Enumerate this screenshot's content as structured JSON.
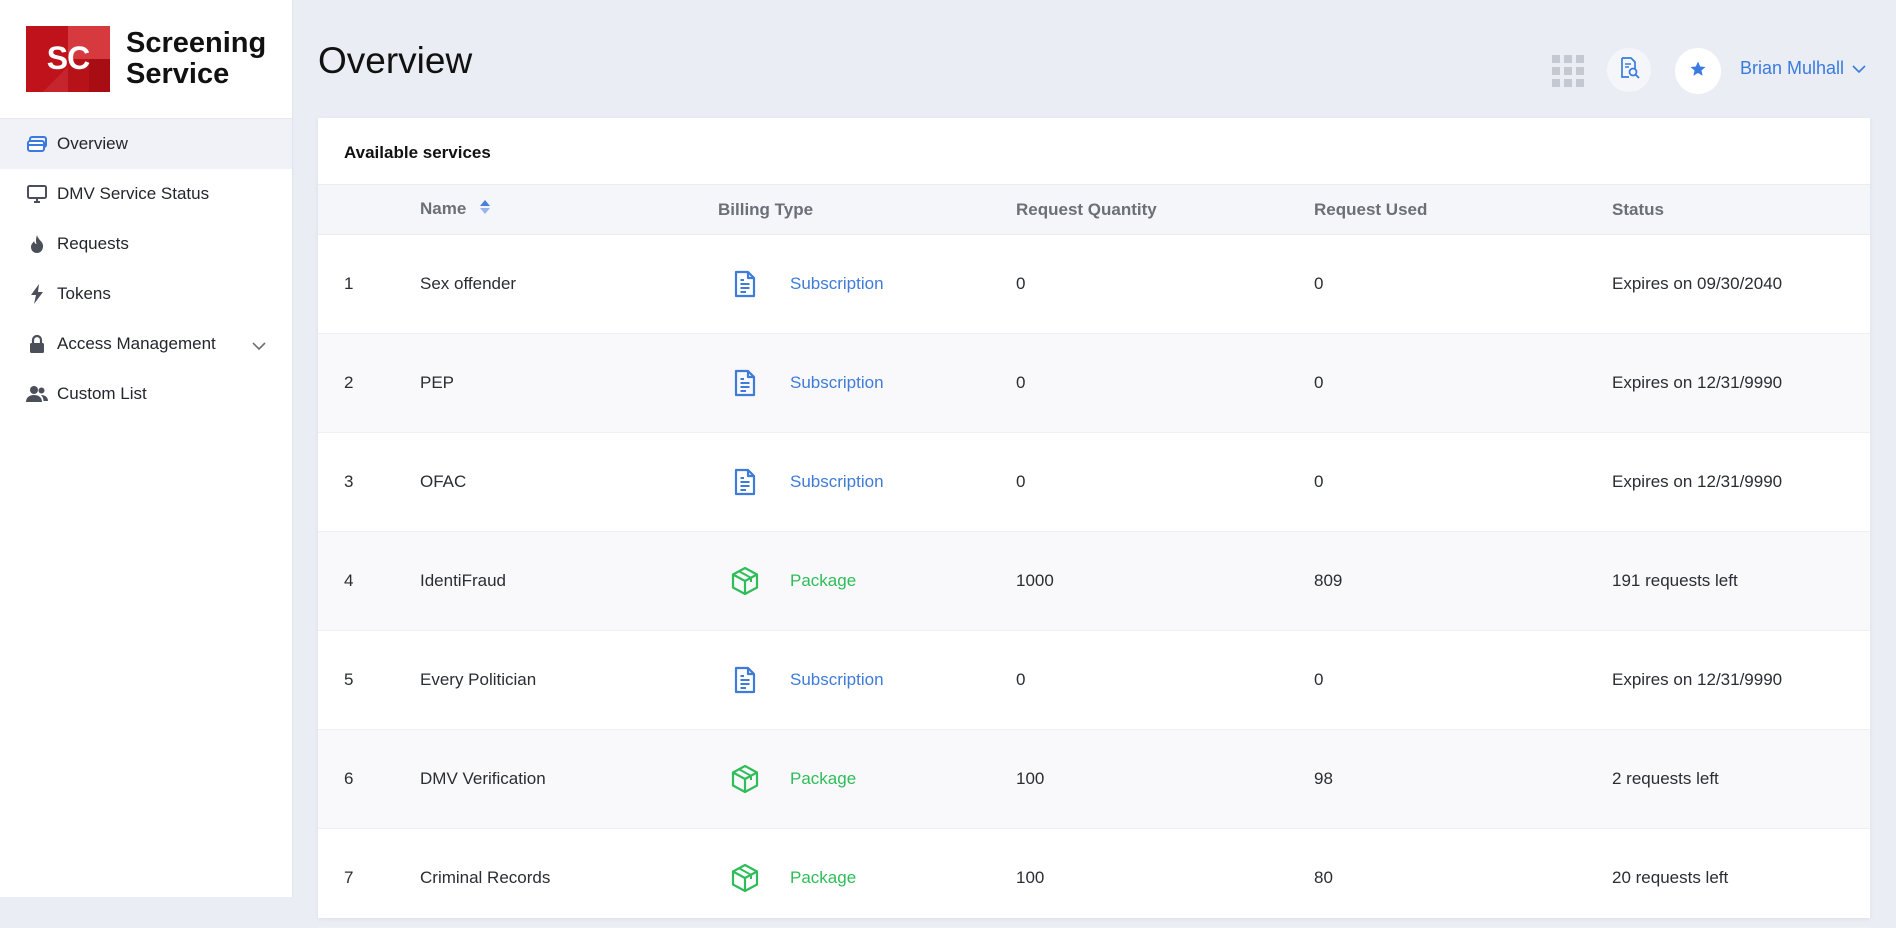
{
  "brand": {
    "logo_text": "SC",
    "name_line1": "Screening",
    "name_line2": "Service"
  },
  "colors": {
    "accent": "#3a7be0",
    "subscription": "#3f7bd8",
    "package": "#2ebd59",
    "logo_red": "#c0121a"
  },
  "sidebar": {
    "items": [
      {
        "label": "Overview",
        "icon": "card-icon",
        "active": true
      },
      {
        "label": "DMV Service Status",
        "icon": "monitor-icon"
      },
      {
        "label": "Requests",
        "icon": "flame-icon"
      },
      {
        "label": "Tokens",
        "icon": "lightning-icon"
      },
      {
        "label": "Access Management",
        "icon": "lock-icon",
        "expandable": true
      },
      {
        "label": "Custom List",
        "icon": "users-icon"
      }
    ]
  },
  "header": {
    "title": "Overview",
    "user_name": "Brian Mulhall",
    "icons": [
      "grid-apps-icon",
      "document-search-icon",
      "star-icon",
      "chevron-down-icon"
    ]
  },
  "services": {
    "title": "Available services",
    "columns": {
      "name": "Name",
      "billing": "Billing Type",
      "qty": "Request Quantity",
      "used": "Request Used",
      "status": "Status"
    },
    "rows": [
      {
        "idx": "1",
        "name": "Sex offender",
        "billing": "Subscription",
        "qty": "0",
        "used": "0",
        "status": "Expires on 09/30/2040"
      },
      {
        "idx": "2",
        "name": "PEP",
        "billing": "Subscription",
        "qty": "0",
        "used": "0",
        "status": "Expires on 12/31/9990"
      },
      {
        "idx": "3",
        "name": "OFAC",
        "billing": "Subscription",
        "qty": "0",
        "used": "0",
        "status": "Expires on 12/31/9990"
      },
      {
        "idx": "4",
        "name": "IdentiFraud",
        "billing": "Package",
        "qty": "1000",
        "used": "809",
        "status": "191 requests left"
      },
      {
        "idx": "5",
        "name": "Every Politician",
        "billing": "Subscription",
        "qty": "0",
        "used": "0",
        "status": "Expires on 12/31/9990"
      },
      {
        "idx": "6",
        "name": "DMV Verification",
        "billing": "Package",
        "qty": "100",
        "used": "98",
        "status": "2 requests left"
      },
      {
        "idx": "7",
        "name": "Criminal Records",
        "billing": "Package",
        "qty": "100",
        "used": "80",
        "status": "20 requests left"
      }
    ]
  }
}
